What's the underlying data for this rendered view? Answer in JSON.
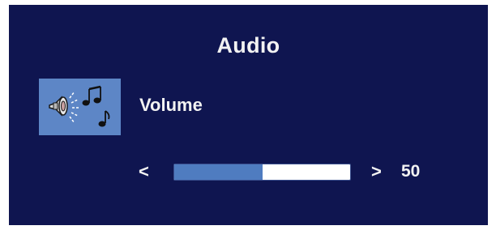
{
  "menu": {
    "title": "Audio",
    "item_label": "Volume",
    "icon": "speaker-with-music-notes-icon"
  },
  "volume": {
    "value": "50",
    "level": 0.5,
    "decrease_symbol": "<",
    "increase_symbol": ">"
  },
  "colors": {
    "background": "#0f1550",
    "icon_background": "#5d86c6",
    "bar_fill": "#4f7cc0",
    "bar_track": "#ffffff",
    "text": "#f2f2f2"
  }
}
